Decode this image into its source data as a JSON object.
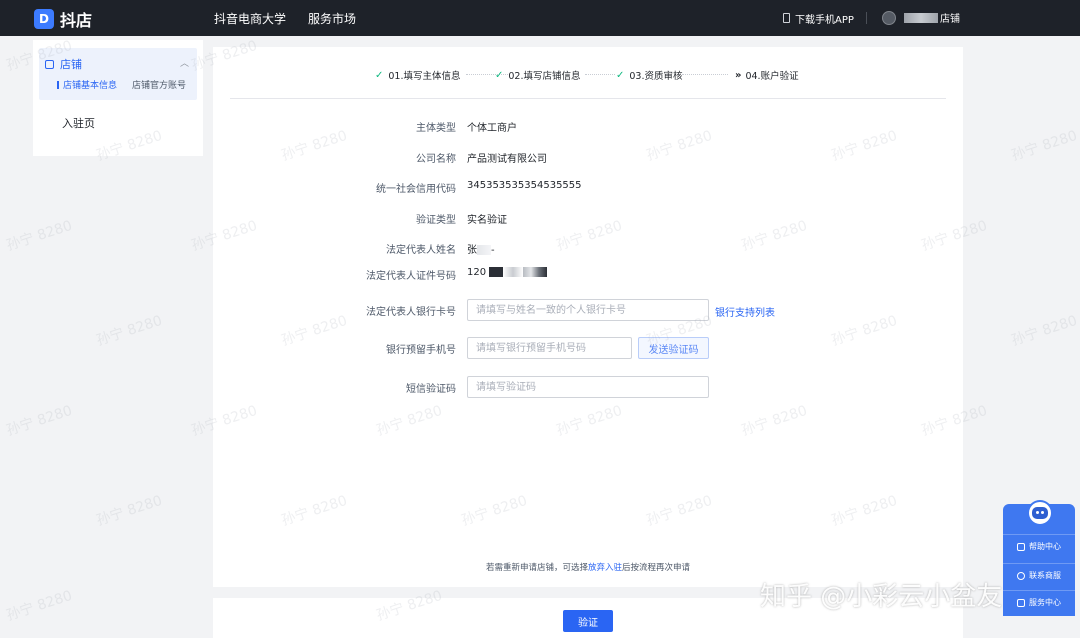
{
  "header": {
    "logo_mark": "D",
    "logo_text": "抖店",
    "nav": [
      "抖音电商大学",
      "服务市场"
    ],
    "download_app": "下载手机APP",
    "user_suffix": "店铺"
  },
  "sidebar": {
    "group_label": "店铺",
    "sub_items": [
      "店铺基本信息",
      "店铺官方账号"
    ],
    "item": "入驻页"
  },
  "steps": [
    {
      "label": "01.填写主体信息",
      "status": "done"
    },
    {
      "label": "02.填写店铺信息",
      "status": "done"
    },
    {
      "label": "03.资质审核",
      "status": "done"
    },
    {
      "label": "04.账户验证",
      "status": "current"
    }
  ],
  "form": {
    "subject_type": {
      "label": "主体类型",
      "value": "个体工商户"
    },
    "company_name": {
      "label": "公司名称",
      "value": "产品测试有限公司"
    },
    "credit_code": {
      "label": "统一社会信用代码",
      "value": "345353535354535555"
    },
    "verify_type": {
      "label": "验证类型",
      "value": "实名验证"
    },
    "legal_name": {
      "label": "法定代表人姓名",
      "value": "张",
      "masked_tail": "-"
    },
    "legal_id": {
      "label": "法定代表人证件号码",
      "value": "120"
    },
    "bank_card": {
      "label": "法定代表人银行卡号",
      "placeholder": "请填写与姓名一致的个人银行卡号",
      "link": "银行支持列表"
    },
    "bank_phone": {
      "label": "银行预留手机号",
      "placeholder": "请填写银行预留手机号码",
      "send_button": "发送验证码"
    },
    "sms_code": {
      "label": "短信验证码",
      "placeholder": "请填写验证码"
    }
  },
  "bottom_note": {
    "prefix": "若需重新申请店铺，可选择",
    "link": "放弃入驻",
    "suffix": "后按流程再次申请"
  },
  "footer": {
    "verify_button": "验证"
  },
  "help_widget": {
    "items": [
      "帮助中心",
      "联系商服",
      "服务中心"
    ]
  },
  "watermark": "孙宁 8280",
  "zhihu_watermark": "知乎 @小彩云小盆友",
  "colors": {
    "primary": "#2a65f3",
    "success": "#10b981",
    "topbar": "#1e2229"
  }
}
